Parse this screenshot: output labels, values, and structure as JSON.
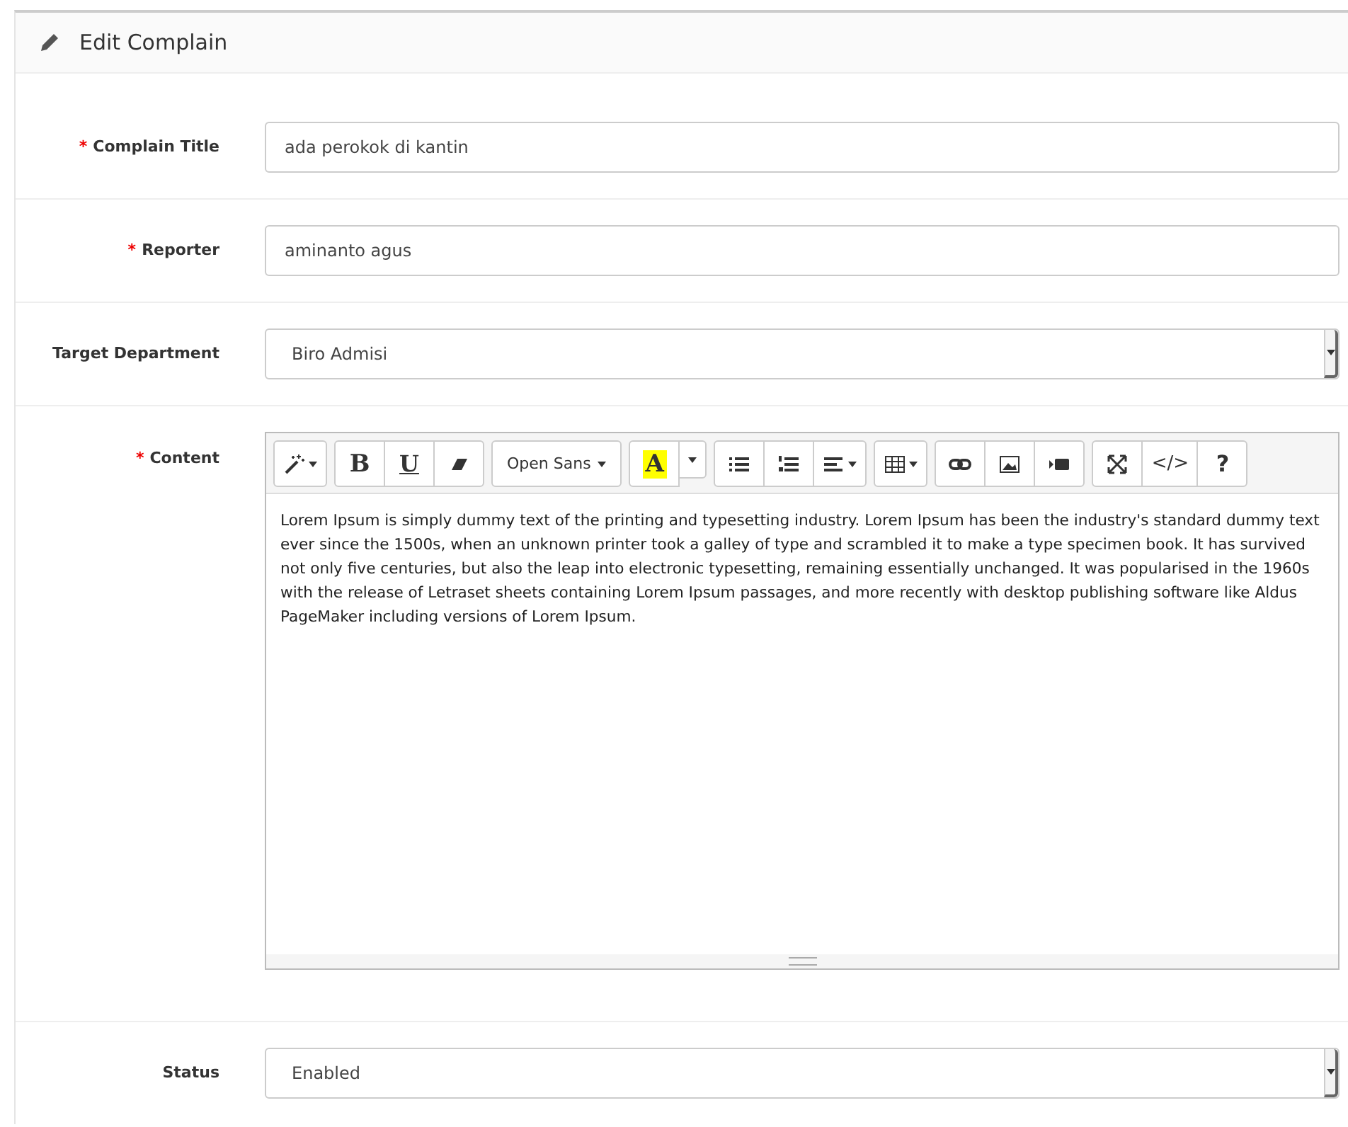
{
  "panel": {
    "title": "Edit Complain"
  },
  "fields": [
    {
      "kind": "text",
      "label": "Complain Title",
      "required_mark": "*",
      "value": "ada perokok di kantin"
    },
    {
      "kind": "text",
      "label": "Reporter",
      "required_mark": "*",
      "value": "aminanto agus"
    },
    {
      "kind": "select",
      "label": "Target Department",
      "value": "Biro Admisi"
    },
    {
      "kind": "editor",
      "label": "Content",
      "required_mark": "*",
      "value": "Lorem Ipsum is simply dummy text of the printing and typesetting industry. Lorem Ipsum has been the industry's standard dummy text ever since the 1500s, when an unknown printer took a galley of type and scrambled it to make a type specimen book. It has survived not only five centuries, but also the leap into electronic typesetting, remaining essentially unchanged. It was popularised in the 1960s with the release of Letraset sheets containing Lorem Ipsum passages, and more recently with desktop publishing software like Aldus PageMaker including versions of Lorem Ipsum."
    },
    {
      "kind": "select",
      "label": "Status",
      "value": "Enabled"
    }
  ],
  "toolbar": [
    [
      {
        "kind": "magic",
        "caret": true
      }
    ],
    [
      {
        "kind": "bold",
        "label": "B"
      },
      {
        "kind": "underline",
        "label": "U"
      },
      {
        "kind": "eraser"
      }
    ],
    [
      {
        "kind": "font",
        "label": "Open Sans",
        "caret": true
      }
    ],
    [
      {
        "kind": "highlight",
        "label": "A"
      },
      {
        "kind": "dropdown",
        "caret": true
      }
    ],
    [
      {
        "kind": "ul"
      },
      {
        "kind": "ol"
      },
      {
        "kind": "align",
        "caret": true
      }
    ],
    [
      {
        "kind": "table",
        "caret": true
      }
    ],
    [
      {
        "kind": "link"
      },
      {
        "kind": "image"
      },
      {
        "kind": "video"
      }
    ],
    [
      {
        "kind": "fullscreen"
      },
      {
        "kind": "code",
        "label": "</>"
      },
      {
        "kind": "help",
        "label": "?"
      }
    ]
  ]
}
